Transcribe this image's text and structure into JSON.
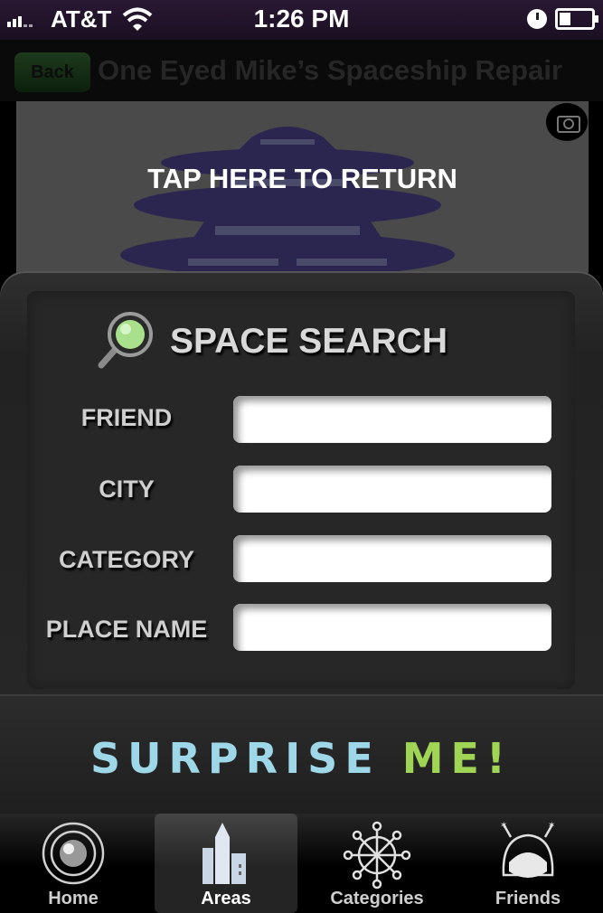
{
  "status_bar": {
    "carrier": "AT&T",
    "time": "1:26 PM"
  },
  "nav": {
    "back_label": "Back",
    "title": "One Eyed Mike’s Spaceship Repair"
  },
  "preview": {
    "overlay_text": "TAP HERE TO RETURN",
    "camera_icon": "camera-icon"
  },
  "search": {
    "title": "SPACE SEARCH",
    "fields": [
      {
        "label": "FRIEND",
        "value": ""
      },
      {
        "label": "CITY",
        "value": ""
      },
      {
        "label": "CATEGORY",
        "value": ""
      },
      {
        "label": "PLACE NAME",
        "value": ""
      }
    ]
  },
  "surprise": {
    "part1": "SURPRISE",
    "part2": "ME!"
  },
  "tabs": [
    {
      "label": "Home",
      "icon": "home-orb-icon",
      "active": false
    },
    {
      "label": "Areas",
      "icon": "city-buildings-icon",
      "active": true
    },
    {
      "label": "Categories",
      "icon": "network-hub-icon",
      "active": false
    },
    {
      "label": "Friends",
      "icon": "astronaut-helmet-icon",
      "active": false
    }
  ],
  "colors": {
    "surprise_primary": "#9ed8e8",
    "surprise_accent": "#9fd454",
    "back_button": "#1d3a1d"
  }
}
